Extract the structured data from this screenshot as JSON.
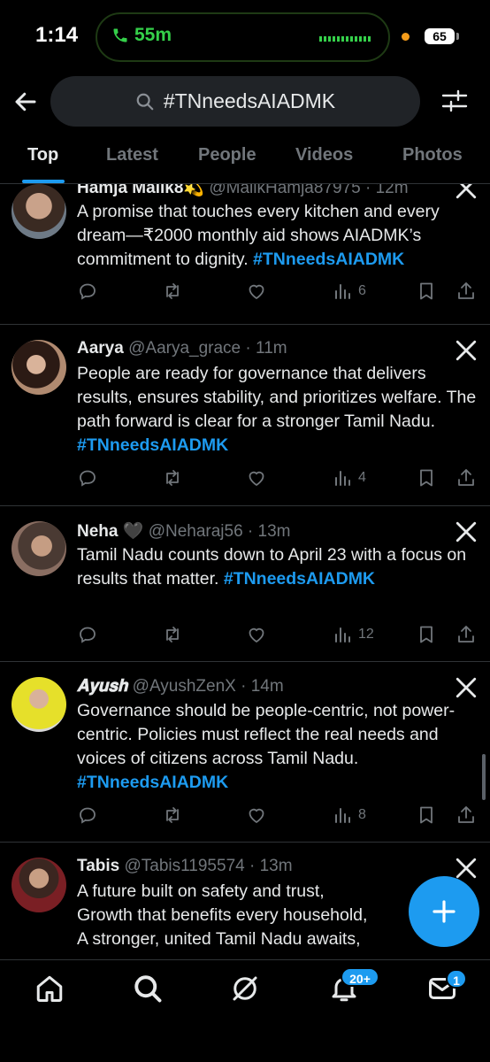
{
  "status_bar": {
    "time": "1:14",
    "call_duration": "55m",
    "battery": "65"
  },
  "search": {
    "query": "#TNneedsAIADMK"
  },
  "tabs": [
    {
      "label": "Top"
    },
    {
      "label": "Latest"
    },
    {
      "label": "People"
    },
    {
      "label": "Videos"
    },
    {
      "label": "Photos"
    }
  ],
  "tweets": [
    {
      "name": "Hamja Malik8💫",
      "handle": "@MalikHamja87975",
      "time": "12m",
      "text": "A promise that touches every kitchen and every dream—₹2000 monthly aid shows AIADMK’s commitment to dignity.",
      "hashtag": "#TNneedsAIADMK",
      "views": "6"
    },
    {
      "name": "Aarya",
      "handle": "@Aarya_grace",
      "time": "11m",
      "text": "People are ready for governance that delivers results, ensures stability, and prioritizes welfare. The path forward is clear for a stronger Tamil Nadu.",
      "hashtag": "#TNneedsAIADMK",
      "views": "4"
    },
    {
      "name": "Neha 🖤",
      "handle": "@Neharaj56",
      "time": "13m",
      "text": "Tamil Nadu counts down to April 23 with a focus on results that matter.",
      "hashtag": "#TNneedsAIADMK",
      "views": "12"
    },
    {
      "name": "𝐀𝐲𝐮𝐬𝐡",
      "handle": "@AyushZenX",
      "time": "14m",
      "text": "Governance should be people-centric, not power-centric. Policies must reflect the real needs and voices of citizens across Tamil Nadu.",
      "hashtag": "#TNneedsAIADMK",
      "views": "8"
    },
    {
      "name": "Tabis",
      "handle": "@Tabis1195574",
      "time": "13m",
      "text": "A future built on safety and trust,\nGrowth that benefits every household,\nA stronger, united Tamil Nadu awaits,",
      "hashtag": "",
      "views": ""
    }
  ],
  "bottom_nav": {
    "notifications_badge": "20+",
    "messages_badge": "1"
  }
}
